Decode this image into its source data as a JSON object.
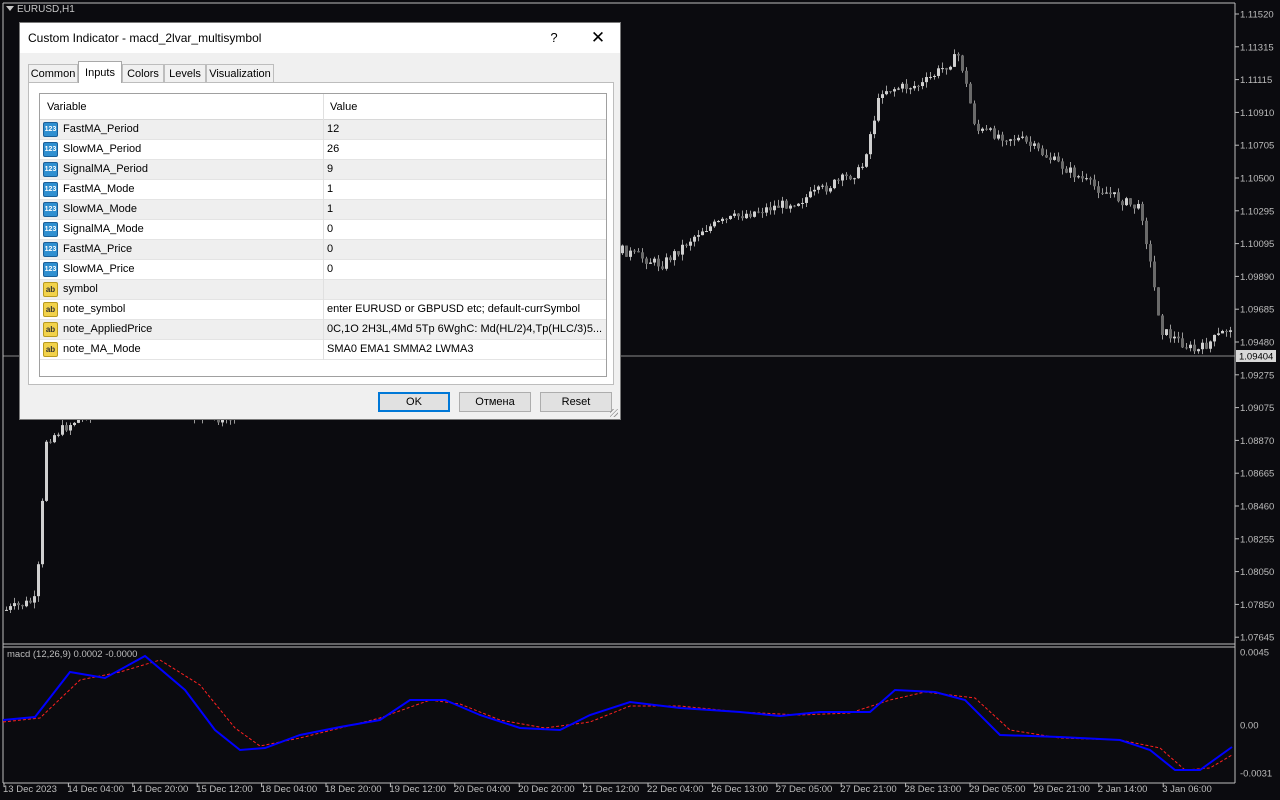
{
  "chart": {
    "symbol": "EURUSD,H1",
    "price_axis": [
      "1.11520",
      "1.11315",
      "1.11115",
      "1.10910",
      "1.10705",
      "1.10500",
      "1.10295",
      "1.10095",
      "1.09890",
      "1.09685",
      "1.09480",
      "1.09275",
      "1.09075",
      "1.08870",
      "1.08665",
      "1.08460",
      "1.08255",
      "1.08050",
      "1.07850",
      "1.07645"
    ],
    "current_price": "1.09404",
    "indicator_label": "macd  (12,26,9) 0.0002 -0.0000",
    "indicator_axis": [
      "0.0045",
      "0.00",
      "-0.0031"
    ],
    "time_axis": [
      "13 Dec 2023",
      "14 Dec 04:00",
      "14 Dec 20:00",
      "15 Dec 12:00",
      "18 Dec 04:00",
      "18 Dec 20:00",
      "19 Dec 12:00",
      "20 Dec 04:00",
      "20 Dec 20:00",
      "21 Dec 12:00",
      "22 Dec 04:00",
      "26 Dec 13:00",
      "27 Dec 05:00",
      "27 Dec 21:00",
      "28 Dec 13:00",
      "29 Dec 05:00",
      "29 Dec 21:00",
      "2 Jan 14:00",
      "3 Jan 06:00"
    ],
    "colors": {
      "background": "#0b0b0f",
      "candle": "#bdbdbd",
      "macd_line": "#0000ff",
      "signal_line": "#ff2020",
      "grid": "#bdbdbd"
    }
  },
  "dialog": {
    "title": "Custom Indicator - macd_2lvar_multisymbol",
    "help_label": "?",
    "close_label": "✕",
    "tabs": [
      {
        "label": "Common",
        "active": false
      },
      {
        "label": "Inputs",
        "active": true
      },
      {
        "label": "Colors",
        "active": false
      },
      {
        "label": "Levels",
        "active": false
      },
      {
        "label": "Visualization",
        "active": false
      }
    ],
    "columns": {
      "variable": "Variable",
      "value": "Value"
    },
    "rows": [
      {
        "type": "num",
        "name": "FastMA_Period",
        "value": "12"
      },
      {
        "type": "num",
        "name": "SlowMA_Period",
        "value": "26"
      },
      {
        "type": "num",
        "name": "SignalMA_Period",
        "value": "9"
      },
      {
        "type": "num",
        "name": "FastMA_Mode",
        "value": "1"
      },
      {
        "type": "num",
        "name": "SlowMA_Mode",
        "value": "1"
      },
      {
        "type": "num",
        "name": "SignalMA_Mode",
        "value": "0"
      },
      {
        "type": "num",
        "name": "FastMA_Price",
        "value": "0"
      },
      {
        "type": "num",
        "name": "SlowMA_Price",
        "value": "0"
      },
      {
        "type": "txt",
        "name": "symbol",
        "value": ""
      },
      {
        "type": "txt",
        "name": "note_symbol",
        "value": "enter EURUSD or GBPUSD etc; default-currSymbol"
      },
      {
        "type": "txt",
        "name": "note_AppliedPrice",
        "value": "0C,1O 2H3L,4Md 5Tp 6WghC: Md(HL/2)4,Tp(HLC/3)5..."
      },
      {
        "type": "txt",
        "name": "note_MA_Mode",
        "value": "SMA0 EMA1 SMMA2 LWMA3"
      }
    ],
    "icon_text": {
      "num": "123",
      "txt": "ab"
    },
    "buttons": {
      "ok": "OK",
      "cancel": "Отмена",
      "reset": "Reset"
    }
  }
}
